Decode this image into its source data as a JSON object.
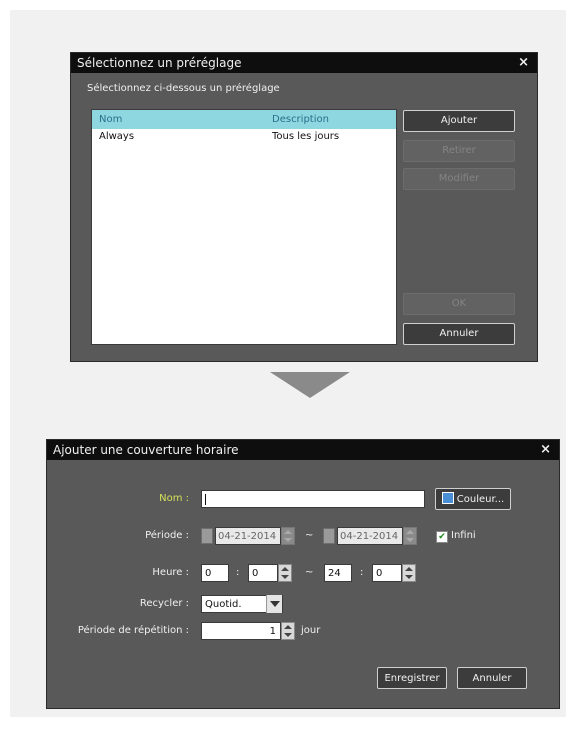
{
  "preset_dialog": {
    "title": "Sélectionnez un préréglage",
    "close": "×",
    "subtitle": "Sélectionnez ci-dessous un préréglage",
    "columns": [
      "Nom",
      "Description"
    ],
    "rows": [
      {
        "name": "Always",
        "description": "Tous les jours"
      }
    ],
    "buttons": {
      "add": "Ajouter",
      "remove": "Retirer",
      "modify": "Modifier",
      "ok": "OK",
      "cancel": "Annuler"
    }
  },
  "schedule_dialog": {
    "title": "Ajouter une couverture horaire",
    "close": "×",
    "name_label": "Nom :",
    "name_value": "",
    "color_button": "Couleur...",
    "period_label": "Période :",
    "start_date": "04-21-2014",
    "end_date": "04-21-2014",
    "range_sep": "~",
    "infinite_label": "Infini",
    "infinite_checked": true,
    "time_label": "Heure :",
    "time_colon": ":",
    "start_hour": "0",
    "start_minute": "0",
    "end_hour": "24",
    "end_minute": "0",
    "recycle_label": "Recycler :",
    "recycle_value": "Quotid.",
    "repeat_label": "Période de répétition :",
    "repeat_value": "1",
    "repeat_unit": "jour",
    "save_button": "Enregistrer",
    "cancel_button": "Annuler"
  },
  "colors": {
    "dialog_bg": "#595959",
    "titlebar_bg": "#0e0e0e",
    "list_header_bg": "#8fd7e0",
    "name_label": "#d4e157",
    "color_swatch": "#4a8fd6"
  }
}
